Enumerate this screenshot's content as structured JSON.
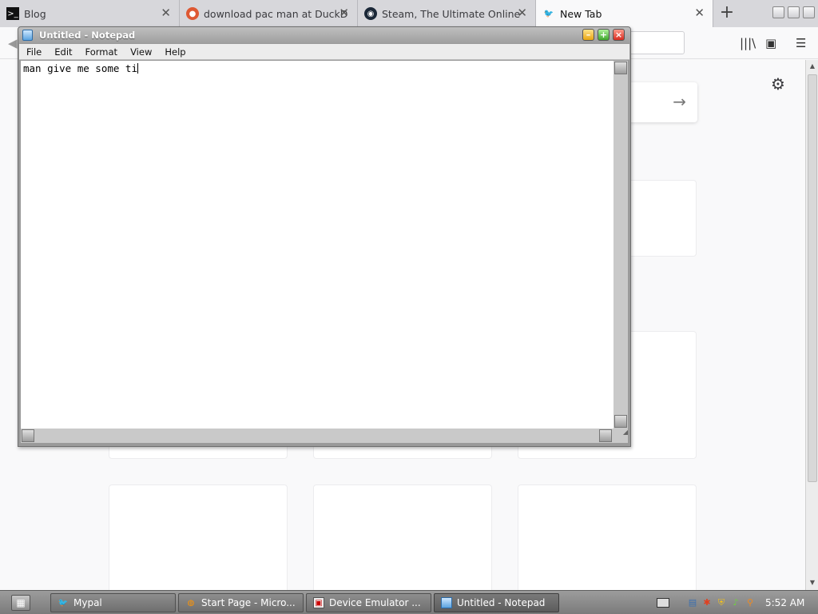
{
  "browser": {
    "tabs": [
      {
        "title": "Blog",
        "icon": "terminal-icon"
      },
      {
        "title": "download pac man at DuckD",
        "icon": "duckduckgo-icon"
      },
      {
        "title": "Steam, The Ultimate Online",
        "icon": "steam-icon"
      },
      {
        "title": "New Tab",
        "icon": "mypal-icon",
        "active": true
      }
    ],
    "new_tab_symbol": "+"
  },
  "notepad": {
    "title": "Untitled - Notepad",
    "menu": [
      "File",
      "Edit",
      "Format",
      "View",
      "Help"
    ],
    "text": "man give me some ti"
  },
  "taskbar": {
    "items": [
      {
        "label": "Mypal",
        "icon": "mypal-icon"
      },
      {
        "label": "Start Page - Micro...",
        "icon": "firefox-icon"
      },
      {
        "label": "Device Emulator ...",
        "icon": "emulator-icon"
      },
      {
        "label": "Untitled - Notepad",
        "icon": "notepad-icon",
        "active": true
      }
    ],
    "clock": "5:52 AM"
  },
  "colors": {
    "accent": "#d7d7db",
    "taskbar": "#8b8b8b"
  }
}
